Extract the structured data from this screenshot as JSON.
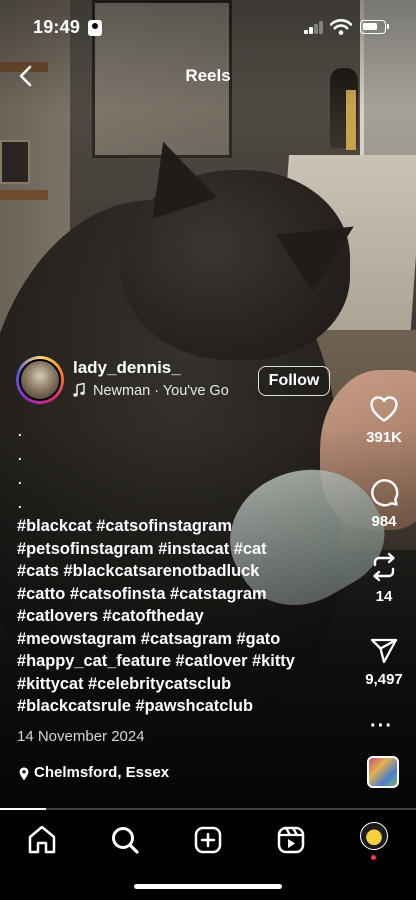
{
  "status_bar": {
    "time": "19:49",
    "signal_bars": 2,
    "battery_level": 0.7
  },
  "header": {
    "title": "Reels",
    "back_icon": "chevron-left-icon"
  },
  "author": {
    "username": "lady_dennis_",
    "music": "Newman · You've Go",
    "follow_label": "Follow"
  },
  "caption": {
    "dots": [
      ".",
      ".",
      ".",
      "."
    ],
    "lines": [
      "#blackcat #catsofinstagram",
      "#petsofinstagram #instacat #cat",
      "#cats #blackcatsarenotbadluck",
      "#catto #catsofinsta #catstagram",
      "#catlovers #catoftheday",
      "#meowstagram #catsagram #gato",
      "#happy_cat_feature #catlover  #kitty",
      "#kittycat #celebritycatsclub",
      "#blackcatsrule  #pawshcatclub"
    ],
    "date": "14 November 2024",
    "location": "Chelmsford, Essex"
  },
  "actions": {
    "likes": "391K",
    "comments": "984",
    "reposts": "14",
    "shares": "9,497",
    "more": "···"
  },
  "video": {
    "progress": 0.11
  },
  "icons": {
    "like": "heart-icon",
    "comment": "comment-bubble-icon",
    "repost": "repost-arrows-icon",
    "share": "send-paper-plane-icon",
    "location": "location-pin-icon",
    "music": "music-note-icon",
    "home": "home-icon",
    "search": "search-icon",
    "create": "plus-square-icon",
    "reels": "reels-icon"
  }
}
